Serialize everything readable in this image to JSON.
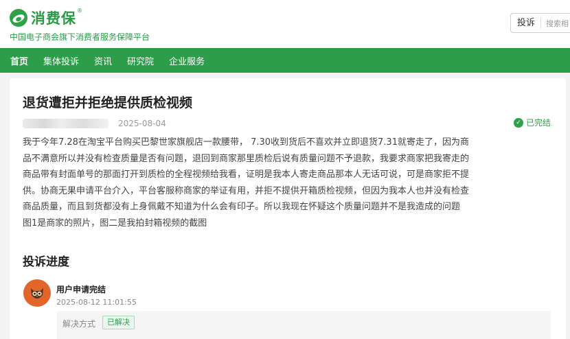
{
  "header": {
    "logo_text": "消费保",
    "logo_reg": "®",
    "tagline": "中国电子商会旗下消费者服务保障平台",
    "search_type": "投诉",
    "search_placeholder": "搜索相"
  },
  "nav": {
    "items": [
      {
        "label": "首页",
        "active": true
      },
      {
        "label": "集体投诉",
        "active": false
      },
      {
        "label": "资讯",
        "active": false
      },
      {
        "label": "研究院",
        "active": false
      },
      {
        "label": "企业服务",
        "active": false
      }
    ]
  },
  "complaint": {
    "title": "退货遭拒并拒绝提供质检视频",
    "date": "2025-08-04",
    "status": "已完结",
    "body_lines": [
      "我于今年7.28在淘宝平台购买巴黎世家旗舰店一款腰带， 7.30收到货后不喜欢并立即退货7.31就寄走了，因为商",
      "品不满意所以并没有检查质量是否有问题，退回到商家那里质检后说有质量问题不予退款，我要求商家把我寄走的",
      "商品带有封面单号的那面打开到质检的全程视频给我看，证明是我本人寄走商品那本人无话可说，可是商家拒不提",
      "供。协商无果申请平台介入，平台客服称商家的举证有用，并拒不提供开箱质检视频，但因为我本人也并没有检查",
      "商品质量，而且到货都没有上身佩戴不知道为什么会有印子。所以我现在怀疑这个质量问题并不是我造成的问题",
      "图1是商家的照片，图二是我拍封箱视频的截图"
    ]
  },
  "progress": {
    "section_title": "投诉进度",
    "entry_title": "用户申请完结",
    "entry_time": "2025-08-12 11:01:55",
    "resolve_label": "解决方式",
    "resolve_value": "已解决"
  },
  "colors": {
    "brand_green": "#2e9d49",
    "page_bg": "#f4f4f4",
    "avatar_orange": "#e2652a"
  },
  "icons": {
    "logo": "leaf-logo-icon",
    "status": "check-circle-icon",
    "avatar": "owl-avatar-icon"
  }
}
